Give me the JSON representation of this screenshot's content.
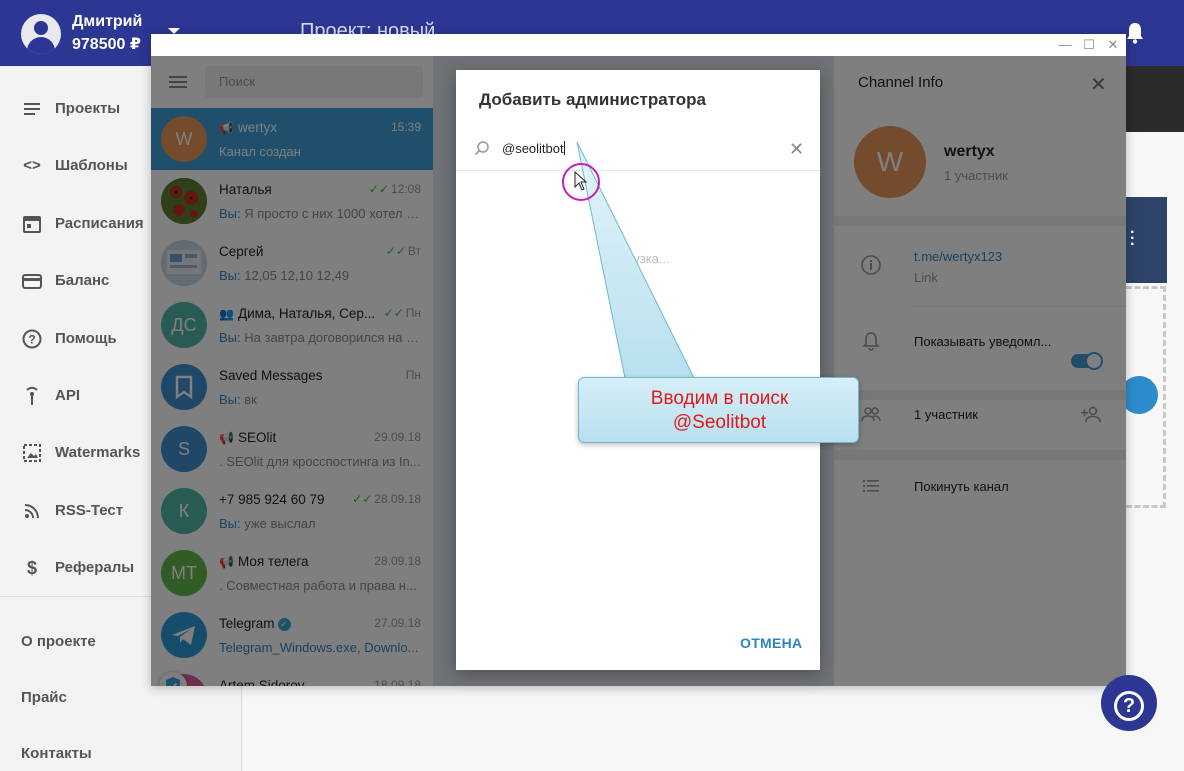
{
  "user": {
    "name": "Дмитрий",
    "balance": "978500 ₽"
  },
  "header": {
    "project_title": "Проект: новый"
  },
  "sidebar": {
    "items": [
      {
        "label": "Проекты",
        "icon": "list-icon"
      },
      {
        "label": "Шаблоны",
        "icon": "code-icon"
      },
      {
        "label": "Расписания",
        "icon": "calendar-icon"
      },
      {
        "label": "Баланс",
        "icon": "card-icon"
      },
      {
        "label": "Помощь",
        "icon": "question-icon"
      },
      {
        "label": "API",
        "icon": "antenna-icon"
      },
      {
        "label": "Watermarks",
        "icon": "image-icon"
      },
      {
        "label": "RSS-Тест",
        "icon": "rss-icon"
      },
      {
        "label": "Рефералы",
        "icon": "dollar-icon"
      }
    ],
    "bottom_links": [
      "О проекте",
      "Прайс",
      "Контакты"
    ]
  },
  "telegram": {
    "search_placeholder": "Поиск",
    "chats": [
      {
        "avatar_letter": "W",
        "avatar_color": "#e8965a",
        "name": "wertyx",
        "time": "15:39",
        "preview_prefix": "",
        "preview": "Канал создан",
        "active": true
      },
      {
        "avatar_letter": "",
        "avatar_color": "#6a8a3a",
        "name": "Наталья",
        "time": "12:08",
        "preview_prefix": "Вы:",
        "preview": "Я просто с них 1000 хотел в..."
      },
      {
        "avatar_letter": "",
        "avatar_color": "#9ab0c4",
        "name": "Сергей",
        "time": "Вт",
        "preview_prefix": "Вы:",
        "preview": "12,05   12,10   12,49"
      },
      {
        "avatar_letter": "ДС",
        "avatar_color": "#4fb7a8",
        "name": "Дима, Наталья, Сер...",
        "time": "Пн",
        "preview_prefix": "Вы:",
        "preview": "На завтра договорился на с..."
      },
      {
        "avatar_letter": "",
        "avatar_color": "#3d8fd1",
        "name": "Saved Messages",
        "time": "Пн",
        "preview_prefix": "Вы:",
        "preview": "вк"
      },
      {
        "avatar_letter": "S",
        "avatar_color": "#3d8fd1",
        "name": "SEOlit",
        "time": "29.09.18",
        "preview_prefix": "",
        "preview": ". SEOlit для кросспостинга из In..."
      },
      {
        "avatar_letter": "К",
        "avatar_color": "#4fb7a8",
        "name": "+7 985 924 60 79",
        "time": "28.09.18",
        "preview_prefix": "Вы:",
        "preview": "уже выслал"
      },
      {
        "avatar_letter": "МТ",
        "avatar_color": "#65b84b",
        "name": "Моя телега",
        "time": "28.09.18",
        "preview_prefix": "",
        "preview": ". Совместная работа и права н..."
      },
      {
        "avatar_letter": "",
        "avatar_color": "#2e9ad8",
        "name": "Telegram",
        "time": "27.09.18",
        "preview_prefix": "",
        "preview": "Telegram_Windows.exe, Downlo..."
      },
      {
        "avatar_letter": "",
        "avatar_color": "#e05c9a",
        "name": "Artem Sidorov",
        "time": "18.09.18",
        "preview_prefix": "",
        "preview": ""
      }
    ],
    "channel_info": {
      "title": "Channel Info",
      "avatar_letter": "W",
      "name": "wertyx",
      "members": "1 участник",
      "link": "t.me/wertyx123",
      "link_label": "Link",
      "notifications": "Показывать уведомл...",
      "members_row": "1 участник",
      "leave": "Покинуть канал"
    }
  },
  "modal": {
    "title": "Добавить администратора",
    "search_value": "@seolitbot",
    "loading": "Загрузка...",
    "cancel": "ОТМЕНА"
  },
  "annotation": {
    "line1": "Вводим в поиск",
    "line2": "@Seolitbot"
  },
  "help": {
    "label": "?"
  }
}
